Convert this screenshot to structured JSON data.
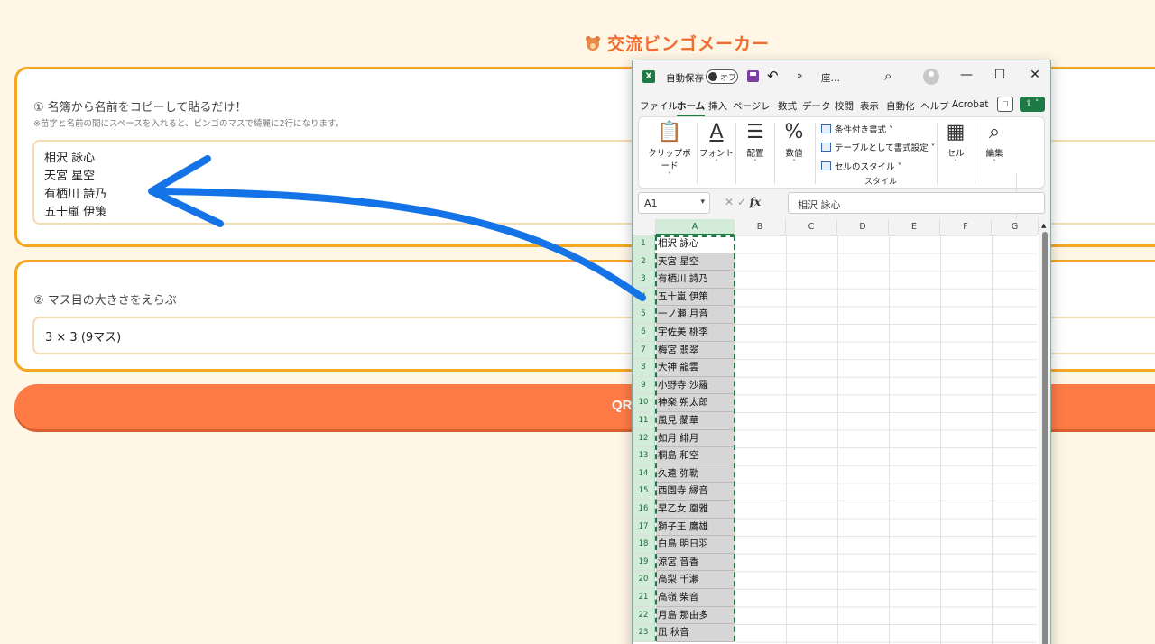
{
  "app": {
    "title": "交流ビンゴメーカー",
    "step1": {
      "label": "① 名簿から名前をコピーして貼るだけ！",
      "note": "※苗字と名前の間にスペースを入れると、ビンゴのマスで綺麗に2行になります。",
      "names": [
        "相沢 詠心",
        "天宮 星空",
        "有栖川 詩乃",
        "五十嵐 伊策"
      ]
    },
    "step2": {
      "label": "② マス目の大きさをえらぶ",
      "selected": "3 × 3 (9マス)"
    },
    "button_label": "QR"
  },
  "excel": {
    "logo": "X",
    "autosave_label": "自動保存",
    "toggle_label": "オフ",
    "undo": "↶",
    "more": "»",
    "filename": "座…",
    "search": "⌕",
    "minimize": "—",
    "maximize": "☐",
    "close": "✕",
    "tabs": [
      "ファイル",
      "ホーム",
      "挿入",
      "ページレ",
      "数式",
      "データ",
      "校閲",
      "表示",
      "自動化",
      "ヘルプ",
      "Acrobat"
    ],
    "active_tab": "ホーム",
    "comment": "☐",
    "share": "⇪ ˅",
    "ribbon": {
      "clipboard": "クリップボード",
      "font": "フォント",
      "align": "配置",
      "number": "数値",
      "cond_format": "条件付き書式 ˅",
      "table_format": "テーブルとして書式設定 ˅",
      "cell_style": "セルのスタイル ˅",
      "style_group": "スタイル",
      "cells": "セル",
      "edit": "編集",
      "expand": "›",
      "collapse": "˅"
    },
    "cell_ref": "A1",
    "formula_value": "相沢 詠心",
    "columns": [
      "A",
      "B",
      "C",
      "D",
      "E",
      "F",
      "G"
    ],
    "rows": [
      "相沢 詠心",
      "天宮 星空",
      "有栖川 詩乃",
      "五十嵐 伊策",
      "一ノ瀬 月音",
      "宇佐美 桃李",
      "梅宮 翡翠",
      "大神 龍雲",
      "小野寺 沙羅",
      "神楽 朔太郎",
      "風見 蘭華",
      "如月 緋月",
      "桐島 和空",
      "久遠 弥勒",
      "西園寺 縁音",
      "早乙女 凰雅",
      "獅子王 鷹雄",
      "白鳥 明日羽",
      "涼宮 音香",
      "高梨 千瀬",
      "高嶺 柴音",
      "月島 那由多",
      "凪 秋音"
    ]
  },
  "colors": {
    "accent": "#f26b2e",
    "border": "#f5a623",
    "button": "#ff7b45",
    "arrow": "#1473e6",
    "excel_green": "#1d7a45"
  }
}
